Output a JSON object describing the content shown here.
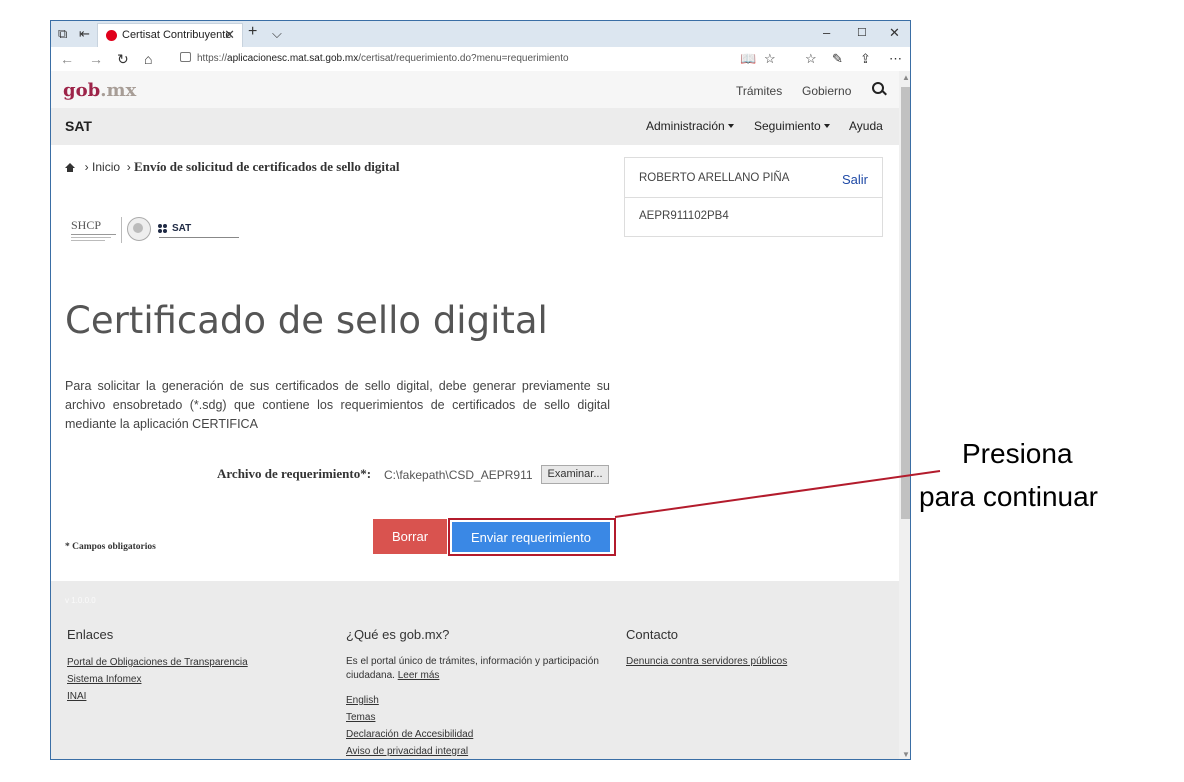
{
  "browser": {
    "tab_title": "Certisat Contribuyente",
    "url_host": "aplicacionesc.mat.sat.gob.mx",
    "url_prefix": "https://",
    "url_path": "/certisat/requerimiento.do?menu=requerimiento"
  },
  "header": {
    "logo_gob": "gob",
    "logo_mx": ".mx",
    "links": [
      "Trámites",
      "Gobierno"
    ]
  },
  "sat_bar": {
    "title": "SAT",
    "menus": [
      "Administración",
      "Seguimiento",
      "Ayuda"
    ]
  },
  "breadcrumb": {
    "home": "Inicio",
    "current": "Envío de solicitud de certificados de sello digital"
  },
  "logos": {
    "shcp": "SHCP",
    "sat": "SAT"
  },
  "user_box": {
    "name": "ROBERTO ARELLANO PIÑA",
    "logout": "Salir",
    "rfc": "AEPR911102PB4"
  },
  "main": {
    "title": "Certificado de sello digital",
    "description": "Para solicitar la generación de sus certificados de sello digital, debe generar previamente su archivo ensobretado (*.sdg) que contiene los requerimientos de certificados de sello digital mediante la aplicación CERTIFICA",
    "file_label": "Archivo de requerimiento*:",
    "file_path": "C:\\fakepath\\CSD_AEPR911",
    "browse_label": "Examinar...",
    "required_note": "* Campos obligatorios",
    "clear_label": "Borrar",
    "submit_label": "Enviar requerimiento"
  },
  "footer": {
    "version": "v 1.0.0.0",
    "col1_title": "Enlaces",
    "col1_links": [
      "Portal de Obligaciones de Transparencia",
      "Sistema Infomex",
      "INAI"
    ],
    "col2_title": "¿Qué es gob.mx?",
    "col2_text": "Es el portal único de trámites, información y participación ciudadana.",
    "col2_more": "Leer más",
    "col2_links": [
      "English",
      "Temas",
      "Declaración de Accesibilidad",
      "Aviso de privacidad integral"
    ],
    "col3_title": "Contacto",
    "col3_link": "Denuncia contra servidores públicos"
  },
  "annotation": {
    "line1": "Presiona",
    "line2": "para continuar"
  },
  "colors": {
    "brand": "#9d2449",
    "submit": "#3a88e5",
    "clear": "#d9534f",
    "highlight": "#b31b2c"
  }
}
